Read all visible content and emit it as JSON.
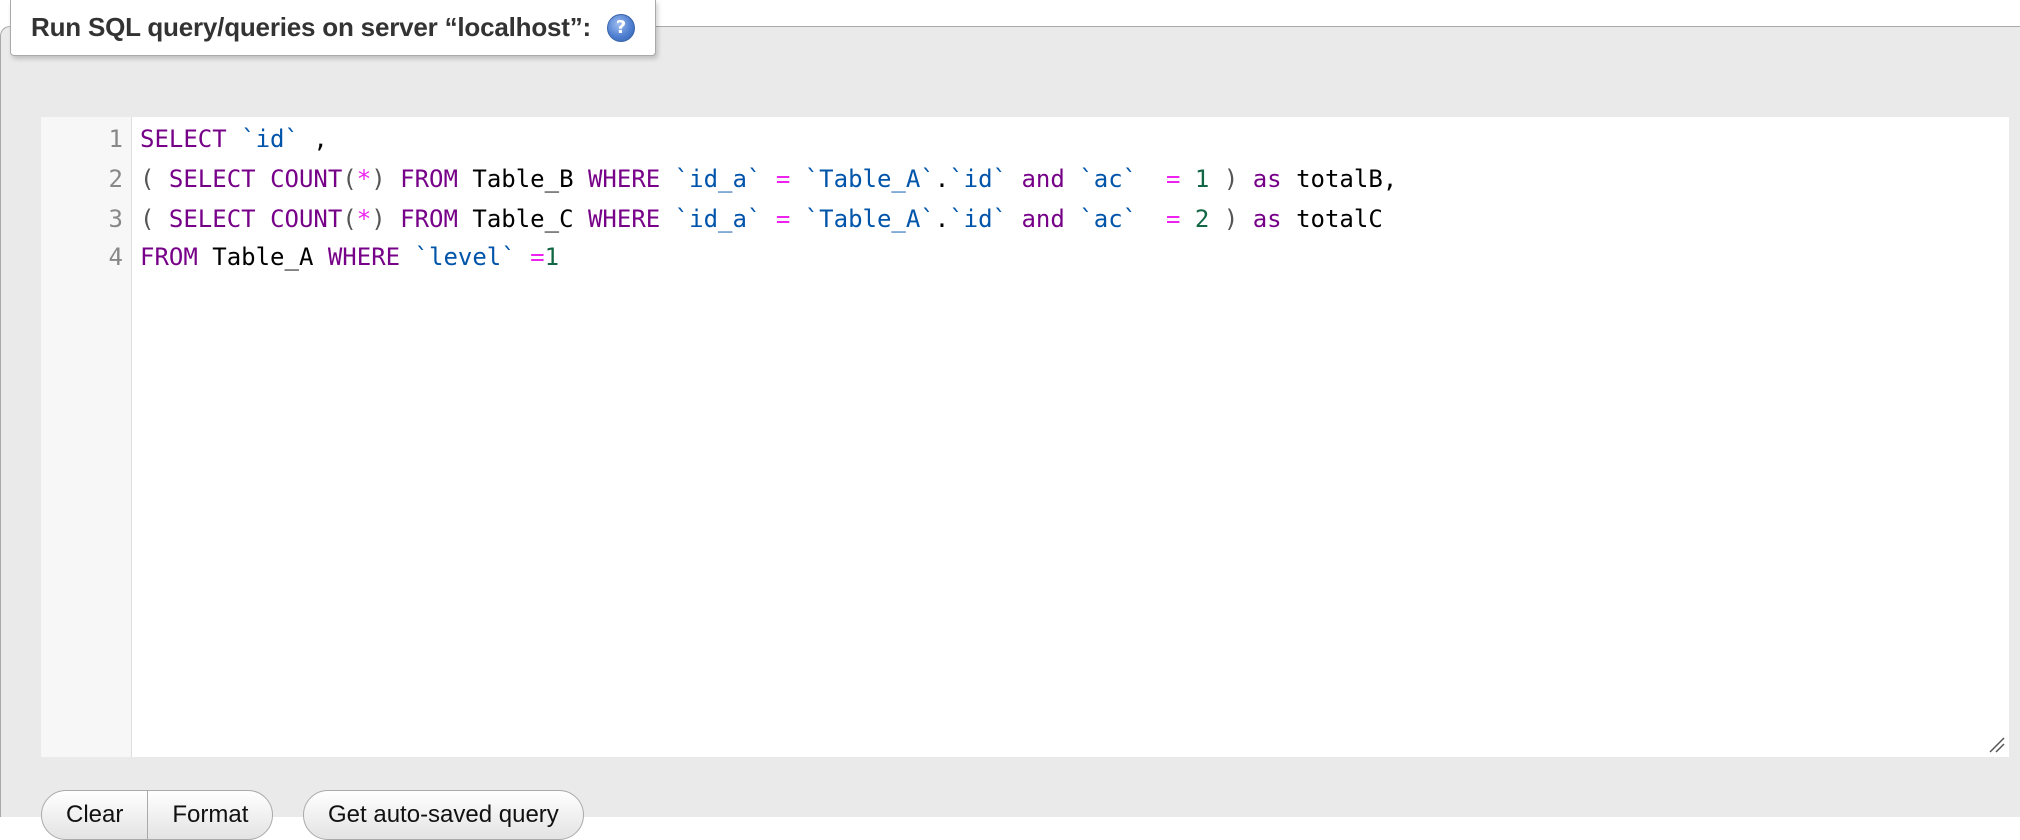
{
  "panel": {
    "title": "Run SQL query/queries on server “localhost”:",
    "help_icon": "help-icon",
    "help_icon_glyph": "?"
  },
  "editor": {
    "line_numbers": [
      "1",
      "2",
      "3",
      "4"
    ],
    "lines": [
      [
        {
          "t": "SELECT",
          "c": "kw"
        },
        {
          "t": " ",
          "c": ""
        },
        {
          "t": "`id`",
          "c": "bt"
        },
        {
          "t": " ,",
          "c": ""
        }
      ],
      [
        {
          "t": "(",
          "c": "br"
        },
        {
          "t": " ",
          "c": ""
        },
        {
          "t": "SELECT",
          "c": "kw"
        },
        {
          "t": " ",
          "c": ""
        },
        {
          "t": "COUNT",
          "c": "kw"
        },
        {
          "t": "(",
          "c": "br"
        },
        {
          "t": "*",
          "c": "op"
        },
        {
          "t": ")",
          "c": "br"
        },
        {
          "t": " ",
          "c": ""
        },
        {
          "t": "FROM",
          "c": "kw"
        },
        {
          "t": " Table_B ",
          "c": ""
        },
        {
          "t": "WHERE",
          "c": "kw"
        },
        {
          "t": " ",
          "c": ""
        },
        {
          "t": "`id_a`",
          "c": "bt"
        },
        {
          "t": " ",
          "c": ""
        },
        {
          "t": "=",
          "c": "op"
        },
        {
          "t": " ",
          "c": ""
        },
        {
          "t": "`Table_A`",
          "c": "bt"
        },
        {
          "t": ".",
          "c": ""
        },
        {
          "t": "`id`",
          "c": "bt"
        },
        {
          "t": " ",
          "c": ""
        },
        {
          "t": "and",
          "c": "kw"
        },
        {
          "t": " ",
          "c": ""
        },
        {
          "t": "`ac`",
          "c": "bt"
        },
        {
          "t": "  ",
          "c": ""
        },
        {
          "t": "=",
          "c": "op"
        },
        {
          "t": " ",
          "c": ""
        },
        {
          "t": "1",
          "c": "num"
        },
        {
          "t": " ",
          "c": ""
        },
        {
          "t": ")",
          "c": "br"
        },
        {
          "t": " ",
          "c": ""
        },
        {
          "t": "as",
          "c": "kw"
        },
        {
          "t": " totalB,",
          "c": ""
        }
      ],
      [
        {
          "t": "(",
          "c": "br"
        },
        {
          "t": " ",
          "c": ""
        },
        {
          "t": "SELECT",
          "c": "kw"
        },
        {
          "t": " ",
          "c": ""
        },
        {
          "t": "COUNT",
          "c": "kw"
        },
        {
          "t": "(",
          "c": "br"
        },
        {
          "t": "*",
          "c": "op"
        },
        {
          "t": ")",
          "c": "br"
        },
        {
          "t": " ",
          "c": ""
        },
        {
          "t": "FROM",
          "c": "kw"
        },
        {
          "t": " Table_C ",
          "c": ""
        },
        {
          "t": "WHERE",
          "c": "kw"
        },
        {
          "t": " ",
          "c": ""
        },
        {
          "t": "`id_a`",
          "c": "bt"
        },
        {
          "t": " ",
          "c": ""
        },
        {
          "t": "=",
          "c": "op"
        },
        {
          "t": " ",
          "c": ""
        },
        {
          "t": "`Table_A`",
          "c": "bt"
        },
        {
          "t": ".",
          "c": ""
        },
        {
          "t": "`id`",
          "c": "bt"
        },
        {
          "t": " ",
          "c": ""
        },
        {
          "t": "and",
          "c": "kw"
        },
        {
          "t": " ",
          "c": ""
        },
        {
          "t": "`ac`",
          "c": "bt"
        },
        {
          "t": "  ",
          "c": ""
        },
        {
          "t": "=",
          "c": "op"
        },
        {
          "t": " ",
          "c": ""
        },
        {
          "t": "2",
          "c": "num"
        },
        {
          "t": " ",
          "c": ""
        },
        {
          "t": ")",
          "c": "br"
        },
        {
          "t": " ",
          "c": ""
        },
        {
          "t": "as",
          "c": "kw"
        },
        {
          "t": " totalC",
          "c": ""
        }
      ],
      [
        {
          "t": "FROM",
          "c": "kw"
        },
        {
          "t": " Table_A ",
          "c": ""
        },
        {
          "t": "WHERE",
          "c": "kw"
        },
        {
          "t": " ",
          "c": ""
        },
        {
          "t": "`level`",
          "c": "bt"
        },
        {
          "t": " ",
          "c": ""
        },
        {
          "t": "=",
          "c": "op"
        },
        {
          "t": "1",
          "c": "num"
        }
      ]
    ],
    "resize_icon": "resize-grip-icon"
  },
  "buttons": {
    "clear_label": "Clear",
    "format_label": "Format",
    "get_auto_saved_label": "Get auto-saved query"
  },
  "colors": {
    "keyword": "#770088",
    "backtick_identifier": "#0055aa",
    "operator": "#ee22ee",
    "number": "#116644",
    "bracket": "#555555",
    "panel_background": "#eaeaea"
  }
}
